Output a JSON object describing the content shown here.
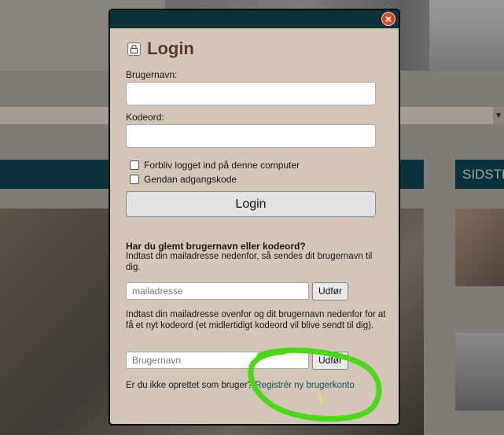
{
  "background": {
    "side_panel_title": "SIDSTE"
  },
  "modal": {
    "title": "Login",
    "username_label": "Brugernavn:",
    "password_label": "Kodeord:",
    "remember_label": "Forbliv logget ind på denne computer",
    "restore_label": "Gendan adgangskode",
    "login_button": "Login",
    "forgot_heading": "Har du glemt brugernavn eller kodeord?",
    "forgot_text": "Indtast din mailadresse nedenfor, så sendes dit brugernavn til dig.",
    "email_placeholder": "mailadresse",
    "email_go": "Udfør",
    "reset_text": "Indtast din mailadresse ovenfor og dit brugernavn nedenfor for at få et nyt kodeord (et midlertidigt kodeord vil blive sendt til dig).",
    "username_placeholder": "Brugernavn",
    "username_go": "Udfør",
    "register_prompt": "Er du ikke oprettet som bruger?",
    "register_link": "Registrér ny brugerkonto"
  },
  "colors": {
    "header": "#0b323c",
    "modal_bg": "#d3c6b7",
    "title": "#5c3a2c",
    "close": "#d84a26",
    "annotation": "#4cd71b"
  },
  "icons": [
    "close-icon",
    "lock-icon",
    "chevron-down-icon"
  ]
}
